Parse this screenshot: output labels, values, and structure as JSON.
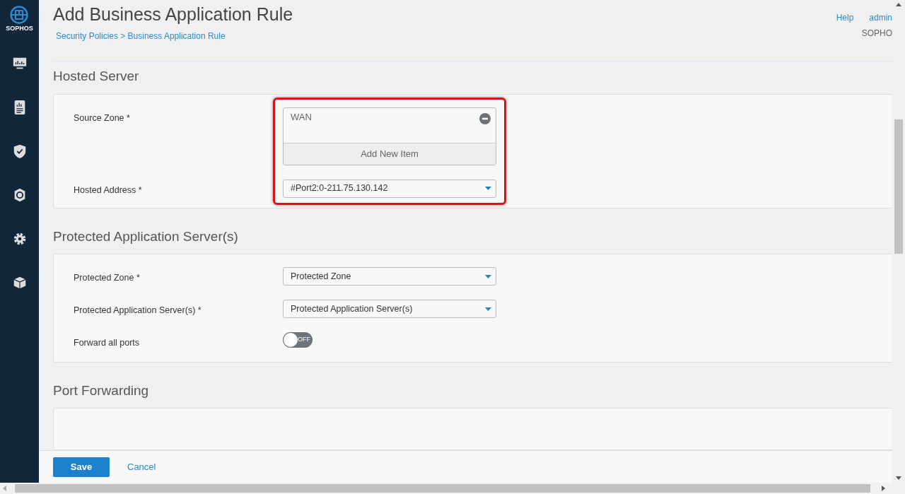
{
  "sidebar": {
    "logo_text": "SOPHOS",
    "items": [
      {
        "kind": "monitor",
        "selected": false
      },
      {
        "kind": "report",
        "selected": false
      },
      {
        "kind": "shield",
        "selected": false
      },
      {
        "kind": "protect",
        "selected": false
      },
      {
        "kind": "gear",
        "selected": false
      },
      {
        "kind": "box",
        "selected": false
      }
    ]
  },
  "header": {
    "title": "Add Business Application Rule",
    "breadcrumb": [
      {
        "label": "Security Policies"
      },
      {
        "label": "Business Application Rule"
      }
    ],
    "separator": ">",
    "links": [
      "Help",
      "admin"
    ],
    "subtitle": "SOPHO"
  },
  "sections": [
    {
      "title": "Hosted Server",
      "highlighted": true,
      "fields": [
        {
          "kind": "list",
          "label": "Source Zone *",
          "items": [
            "WAN"
          ],
          "add_label": "Add New Item"
        },
        {
          "kind": "select",
          "label": "Hosted Address *",
          "value": "#Port2:0-211.75.130.142"
        }
      ]
    },
    {
      "title": "Protected Application Server(s)",
      "highlighted": false,
      "fields": [
        {
          "kind": "select",
          "label": "Protected Zone *",
          "value": "Protected Zone"
        },
        {
          "kind": "select",
          "label": "Protected Application Server(s) *",
          "value": "Protected Application Server(s)"
        },
        {
          "kind": "toggle",
          "label": "Forward all ports",
          "on": false,
          "text": "OFF"
        }
      ]
    },
    {
      "title": "Port Forwarding",
      "highlighted": false
    }
  ],
  "footer": {
    "save": "Save",
    "cancel": "Cancel"
  }
}
